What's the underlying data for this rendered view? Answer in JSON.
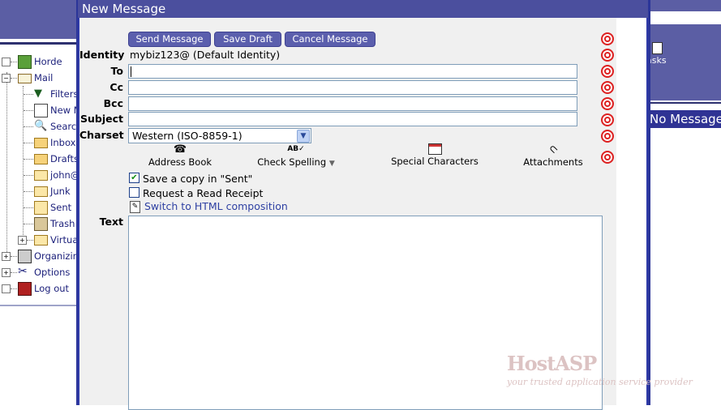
{
  "compose": {
    "title": "New Message",
    "buttons": {
      "send": "Send Message",
      "draft": "Save Draft",
      "cancel": "Cancel Message"
    },
    "identity_label": "Identity",
    "identity_value": "mybiz123@ (Default Identity)",
    "to_label": "To",
    "to_value": "",
    "cc_label": "Cc",
    "cc_value": "",
    "bcc_label": "Bcc",
    "bcc_value": "",
    "subject_label": "Subject",
    "subject_value": "",
    "charset_label": "Charset",
    "charset_value": "Western (ISO-8859-1)",
    "tools": {
      "address_book": "Address Book",
      "check_spelling": "Check Spelling",
      "special_characters": "Special Characters",
      "attachments": "Attachments"
    },
    "save_copy_label": "Save a copy in \"Sent\"",
    "save_copy_checked": true,
    "read_receipt_label": "Request a Read Receipt",
    "read_receipt_checked": false,
    "html_link": "Switch to HTML composition",
    "text_label": "Text",
    "text_value": ""
  },
  "sidebar": {
    "items": [
      {
        "label": "Horde",
        "icon": "horde-icon"
      },
      {
        "label": "Mail",
        "icon": "mail-icon"
      },
      {
        "label": "Filters",
        "icon": "filter-icon"
      },
      {
        "label": "New M",
        "icon": "new-message-icon"
      },
      {
        "label": "Search",
        "icon": "search-icon"
      },
      {
        "label": "Inbox",
        "icon": "inbox-icon"
      },
      {
        "label": "Drafts",
        "icon": "drafts-icon"
      },
      {
        "label": "john@",
        "icon": "folder-icon"
      },
      {
        "label": "Junk",
        "icon": "folder-icon"
      },
      {
        "label": "Sent",
        "icon": "sent-icon"
      },
      {
        "label": "Trash",
        "icon": "trash-icon"
      },
      {
        "label": "Virtual",
        "icon": "folder-icon"
      },
      {
        "label": "Organizing",
        "icon": "organizing-icon"
      },
      {
        "label": "Options",
        "icon": "options-icon"
      },
      {
        "label": "Log out",
        "icon": "logout-icon"
      }
    ]
  },
  "background_right": {
    "tasks_label": "asks",
    "title": "No Message"
  },
  "watermark": {
    "brand": "HostASP",
    "tagline": "your trusted application service provider"
  },
  "colors": {
    "window_border": "#2f3aa8",
    "titlebar": "#4b4f9e",
    "button": "#5b5fad",
    "link": "#2f41a3",
    "help_icon": "#dd2222"
  }
}
